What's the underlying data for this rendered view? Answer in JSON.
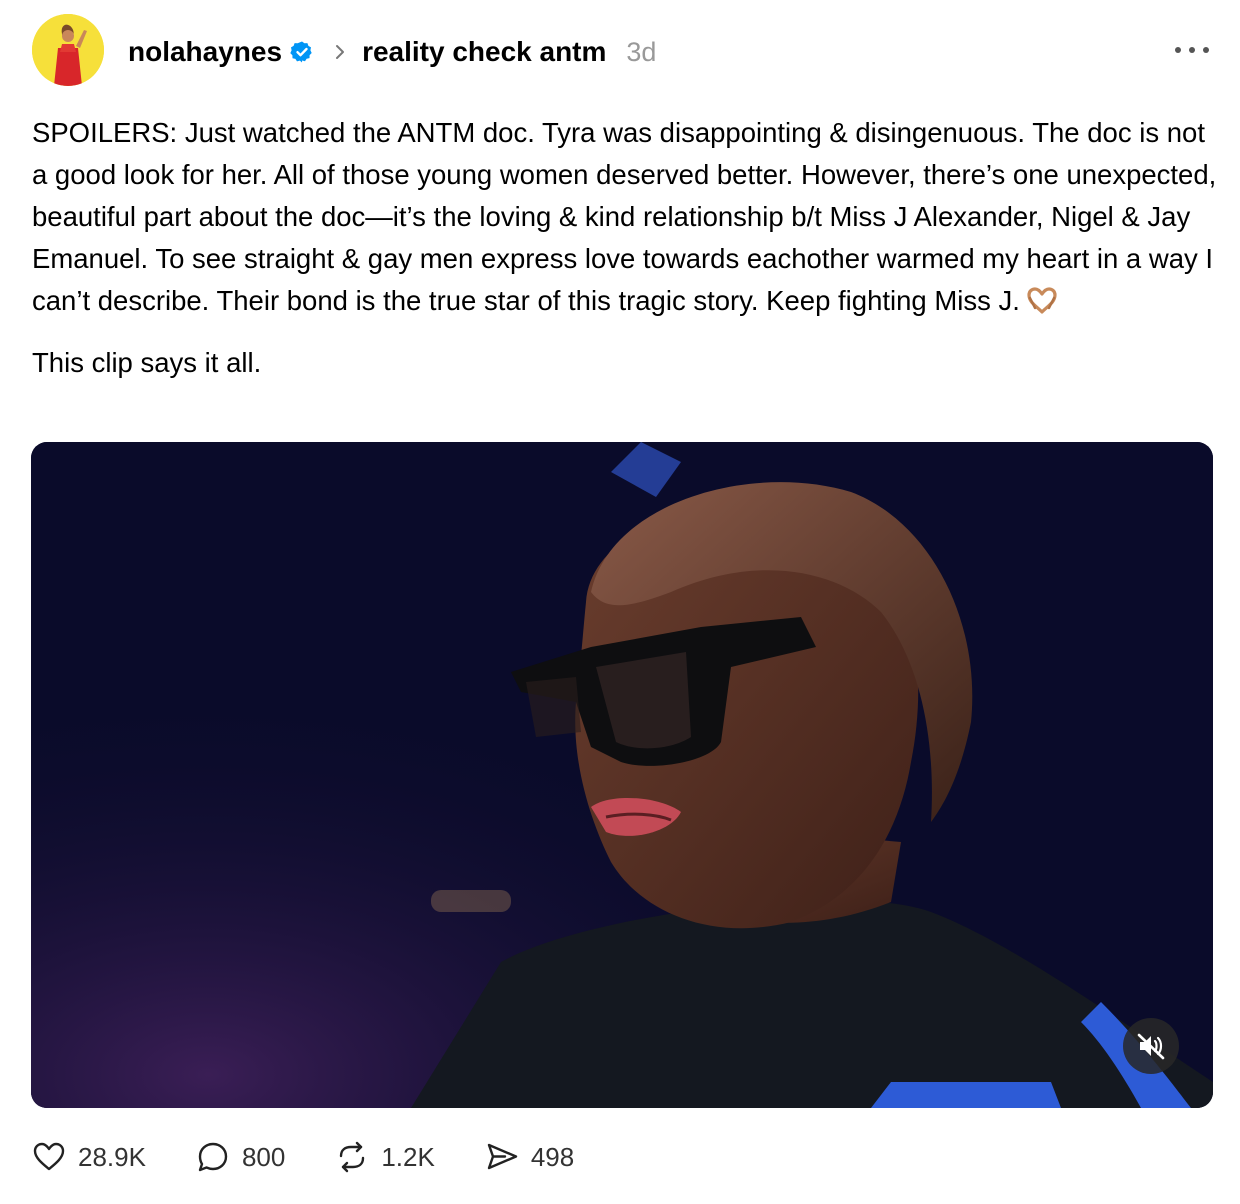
{
  "post": {
    "username": "nolahaynes",
    "community": "reality check antm",
    "timestamp": "3d",
    "body_paragraph_1": "SPOILERS: Just watched the ANTM doc. Tyra was disappointing & disingenuous. The doc is not a good look for her. All of those young women deserved better. However, there’s one unexpected, beautiful part about the doc—it’s the loving & kind relationship b/t Miss J Alexander, Nigel & Jay Emanuel. To see straight & gay men express love towards eachother warmed my heart in a way I can’t describe. Their bond is the true star of this tragic story. Keep fighting Miss J.",
    "body_paragraph_2": "This clip says it all.",
    "emoji": "heart-hands-emoji"
  },
  "video": {
    "muted": true,
    "mute_icon": "speaker-muted-icon"
  },
  "actions": {
    "likes": "28.9K",
    "replies": "800",
    "reposts": "1.2K",
    "shares": "498"
  },
  "icons": {
    "verified": "verified-badge-icon",
    "chevron": "chevron-right-icon",
    "more": "more-options-icon",
    "like": "heart-icon",
    "reply": "comment-icon",
    "repost": "repost-icon",
    "share": "share-icon"
  },
  "colors": {
    "verified_blue": "#0095f6",
    "timestamp_gray": "#999999",
    "avatar_bg": "#f6e03a"
  }
}
